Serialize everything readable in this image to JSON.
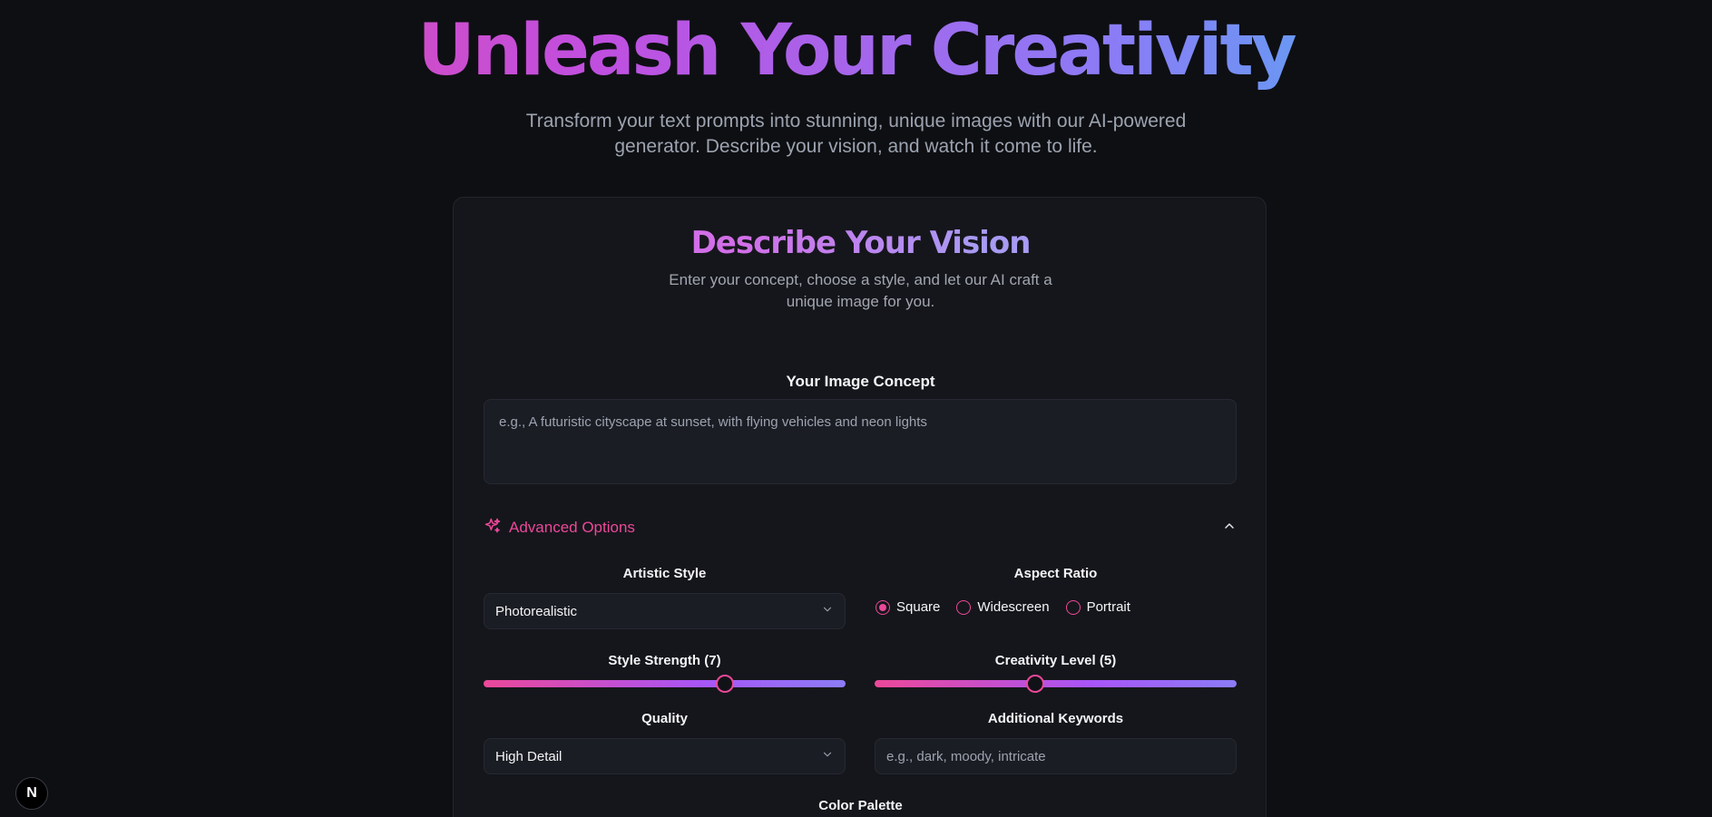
{
  "hero": {
    "title": "Unleash Your Creativity",
    "subtitle": "Transform your text prompts into stunning, unique images with our AI-powered generator. Describe your vision, and watch it come to life."
  },
  "card": {
    "title": "Describe Your Vision",
    "subtitle": "Enter your concept, choose a style, and let our AI craft a unique image for you.",
    "concept_label": "Your Image Concept",
    "concept_placeholder": "e.g., A futuristic cityscape at sunset, with flying vehicles and neon lights",
    "advanced": {
      "label": "Advanced Options",
      "icon": "sparkles-icon",
      "expanded": true
    },
    "artistic_style": {
      "label": "Artistic Style",
      "value": "Photorealistic"
    },
    "aspect_ratio": {
      "label": "Aspect Ratio",
      "options": [
        "Square",
        "Widescreen",
        "Portrait"
      ],
      "selected": "Square"
    },
    "style_strength": {
      "label": "Style Strength (7)",
      "value": 7,
      "min": 1,
      "max": 10
    },
    "creativity_level": {
      "label": "Creativity Level (5)",
      "value": 5,
      "min": 1,
      "max": 10
    },
    "quality": {
      "label": "Quality",
      "value": "High Detail"
    },
    "keywords": {
      "label": "Additional Keywords",
      "placeholder": "e.g., dark, moody, intricate"
    },
    "color_palette": {
      "label": "Color Palette"
    }
  },
  "badge": {
    "letter": "N"
  },
  "colors": {
    "accent": "#ec4899",
    "background": "#0e0f13",
    "card": "#15161b"
  }
}
